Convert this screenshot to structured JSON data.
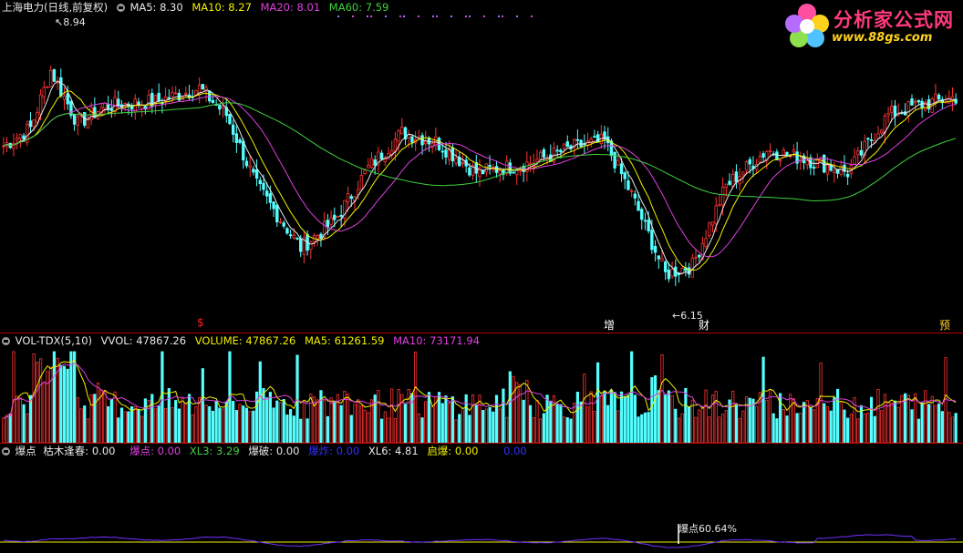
{
  "price_pane": {
    "stock_name": "上海电力",
    "period": "(日线,前复权)",
    "ma5": {
      "label": "MA5: 8.30",
      "color": "#e8e8e8"
    },
    "ma10": {
      "label": "MA10: 8.27",
      "color": "#f0f000"
    },
    "ma20": {
      "label": "MA20: 8.01",
      "color": "#e040e0"
    },
    "ma60": {
      "label": "MA60: 7.59",
      "color": "#40d040"
    },
    "high_label": "8.94",
    "low_label": "6.15",
    "events": [
      {
        "text": "$",
        "color": "#ff2020"
      },
      {
        "text": "增",
        "color": "#ffffff"
      },
      {
        "text": "财",
        "color": "#ffffff"
      },
      {
        "text": "预",
        "color": "#ffd21f"
      }
    ]
  },
  "vol_pane": {
    "name": "VOL-TDX(5,10)",
    "vvol": "VVOL: 47867.26",
    "volume": "VOLUME: 47867.26",
    "ma5": "MA5: 61261.59",
    "ma10": "MA10: 73171.94"
  },
  "ind_pane": {
    "name": "爆点",
    "f1": "枯木逢春: 0.00",
    "f2": "爆点: 0.00",
    "f3": "XL3: 3.29",
    "f4": "爆破: 0.00",
    "f5": "爆炸: 0.00",
    "f6": "XL6: 4.81",
    "f7": "启爆: 0.00",
    "f8": "0.00",
    "annotation": "爆点60.64%"
  },
  "logo": {
    "title": "分析家公式网",
    "url": "www.88gs.com"
  },
  "colors": {
    "up": "#ff3232",
    "down": "#54ffff",
    "ma5": "#e8e8e8",
    "ma10": "#f0f000",
    "ma20": "#e040e0",
    "ma60": "#40d040",
    "divider": "#b00000"
  },
  "chart_data": {
    "type": "candlestick",
    "title": "",
    "y_high": 8.94,
    "y_low": 6.15,
    "ma": {
      "ma5": 8.3,
      "ma10": 8.27,
      "ma20": 8.01,
      "ma60": 7.59
    },
    "volume": {
      "vvol": 47867.26,
      "ma5": 61261.59,
      "ma10": 73171.94
    }
  }
}
